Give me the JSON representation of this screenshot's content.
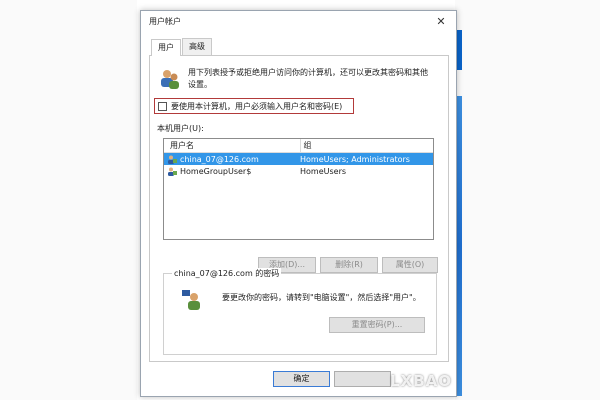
{
  "window": {
    "title": "用户帐户",
    "close_glyph": "✕"
  },
  "tabs": [
    {
      "label": "用户",
      "active": true
    },
    {
      "label": "高级",
      "active": false
    }
  ],
  "intro": {
    "text": "用下列表授予或拒绝用户访问你的计算机，还可以更改其密码和其他设置。"
  },
  "login_checkbox": {
    "label": "要使用本计算机，用户必须输入用户名和密码(E)",
    "checked": false
  },
  "users_section": {
    "label": "本机用户(U):",
    "columns": [
      "用户名",
      "组"
    ],
    "rows": [
      {
        "name": "china_07@126.com",
        "group": "HomeUsers; Administrators",
        "selected": true
      },
      {
        "name": "HomeGroupUser$",
        "group": "HomeUsers",
        "selected": false
      }
    ]
  },
  "list_buttons": {
    "add": "添加(D)...",
    "delete": "删除(R)",
    "properties": "属性(O)"
  },
  "password_section": {
    "legend": "china_07@126.com 的密码",
    "text": "要更改你的密码，请转到\"电脑设置\"，然后选择\"用户\"。",
    "reset_button": "重置密码(P)..."
  },
  "dialog_buttons": {
    "ok": "确定"
  },
  "watermark": "LXBAO",
  "colors": {
    "selection": "#3296e8",
    "checkbox_highlight_border": "#b23a3a",
    "desktop_blue": "#1f6fd0"
  }
}
